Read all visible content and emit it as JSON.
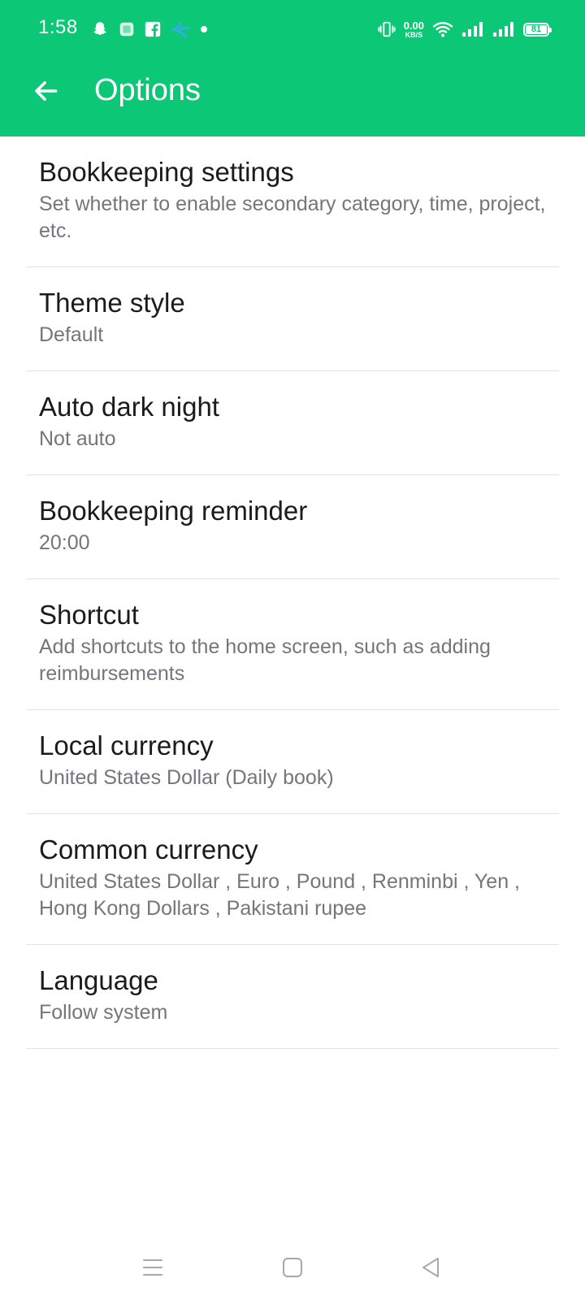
{
  "status_bar": {
    "time": "1:58",
    "net_speed_value": "0.00",
    "net_speed_unit": "KB/S",
    "battery_level": "81",
    "left_icons": [
      "snapchat-icon",
      "gallery-icon",
      "facebook-icon",
      "telenor-icon",
      "notification-dot-icon"
    ],
    "right_icons": [
      "vibrate-icon",
      "wifi-icon",
      "signal-icon",
      "signal-icon",
      "battery-icon"
    ]
  },
  "header": {
    "title": "Options",
    "back_icon": "arrow-back-icon",
    "background_color": "#0CC775"
  },
  "options": [
    {
      "title": "Bookkeeping settings",
      "subtitle": "Set whether to enable secondary category, time, project, etc."
    },
    {
      "title": "Theme style",
      "subtitle": "Default"
    },
    {
      "title": "Auto dark night",
      "subtitle": "Not auto"
    },
    {
      "title": "Bookkeeping reminder",
      "subtitle": "20:00"
    },
    {
      "title": "Shortcut",
      "subtitle": "Add shortcuts to the home screen, such as adding reimbursements"
    },
    {
      "title": "Local currency",
      "subtitle": "United States Dollar (Daily book)"
    },
    {
      "title": "Common currency",
      "subtitle": "United States Dollar , Euro , Pound , Renminbi , Yen , Hong Kong Dollars , Pakistani rupee"
    },
    {
      "title": "Language",
      "subtitle": "Follow system"
    }
  ],
  "nav_bar": {
    "icons": [
      "menu-icon",
      "home-icon",
      "back-icon"
    ]
  }
}
